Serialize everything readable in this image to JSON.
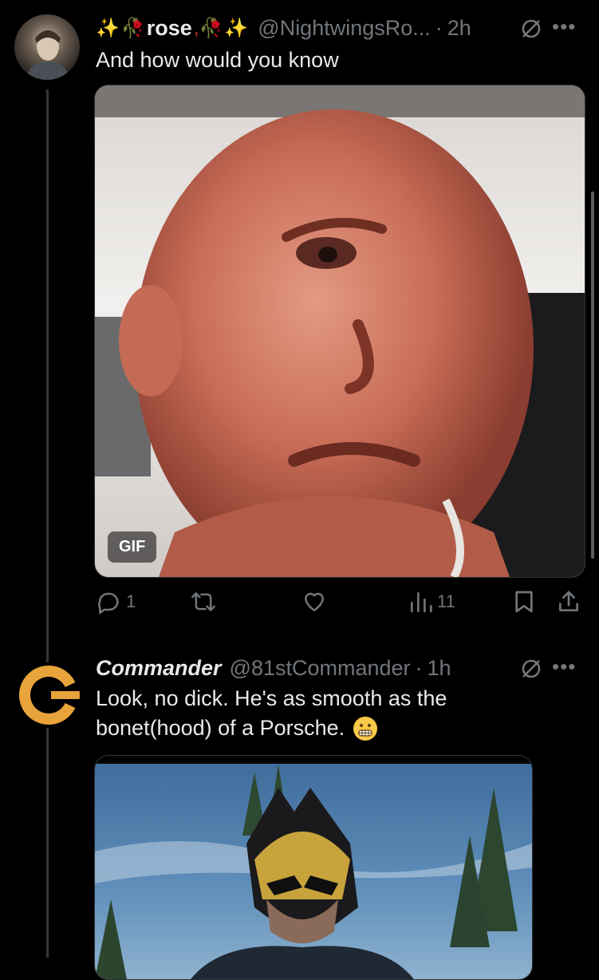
{
  "tweet1": {
    "display_name": "rose",
    "handle": "@NightwingsRo...",
    "sep": "·",
    "time": "2h",
    "text": "And how would you know",
    "gif_label": "GIF",
    "actions": {
      "replies": "1",
      "retweets": "",
      "likes": "",
      "views": "11"
    }
  },
  "tweet2": {
    "display_name": "Commander",
    "handle": "@81stCommander",
    "sep": "·",
    "time": "1h",
    "text_line1": "Look, no dick. He's as smooth as the",
    "text_line2": "bonet(hood) of a Porsche.",
    "emoji": "grimacing-face"
  },
  "icons": {
    "more": "•••",
    "mute": "slashed-circle-icon"
  },
  "colors": {
    "background": "#000000",
    "muted": "#71767b",
    "text": "#e7e9ea",
    "commander_logo": "#e8a33a"
  }
}
